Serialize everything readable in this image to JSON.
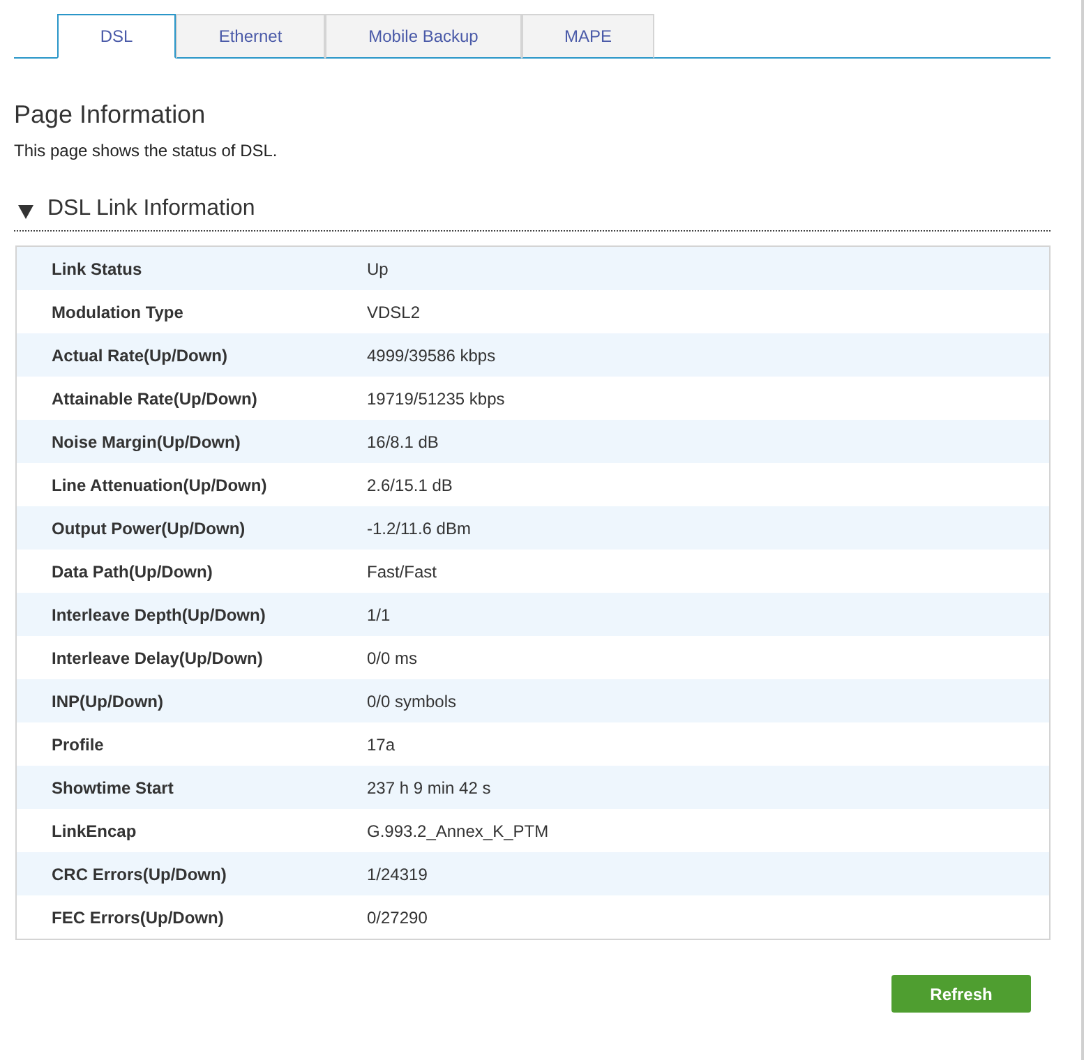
{
  "tabs": [
    {
      "label": "DSL",
      "selected": true
    },
    {
      "label": "Ethernet",
      "selected": false
    },
    {
      "label": "Mobile Backup",
      "selected": false
    },
    {
      "label": "MAPE",
      "selected": false
    }
  ],
  "page": {
    "title": "Page Information",
    "description": "This page shows the status of DSL."
  },
  "section": {
    "title": "DSL Link Information",
    "expanded": true,
    "rows": [
      {
        "label": "Link Status",
        "value": "Up"
      },
      {
        "label": "Modulation Type",
        "value": "VDSL2"
      },
      {
        "label": "Actual Rate(Up/Down)",
        "value": "4999/39586 kbps"
      },
      {
        "label": "Attainable Rate(Up/Down)",
        "value": "19719/51235 kbps"
      },
      {
        "label": "Noise Margin(Up/Down)",
        "value": "16/8.1 dB"
      },
      {
        "label": "Line Attenuation(Up/Down)",
        "value": "2.6/15.1 dB"
      },
      {
        "label": "Output Power(Up/Down)",
        "value": "-1.2/11.6 dBm"
      },
      {
        "label": "Data Path(Up/Down)",
        "value": "Fast/Fast"
      },
      {
        "label": "Interleave Depth(Up/Down)",
        "value": "1/1"
      },
      {
        "label": "Interleave Delay(Up/Down)",
        "value": "0/0 ms"
      },
      {
        "label": "INP(Up/Down)",
        "value": "0/0 symbols"
      },
      {
        "label": "Profile",
        "value": "17a"
      },
      {
        "label": "Showtime Start",
        "value": "237 h 9 min 42 s"
      },
      {
        "label": "LinkEncap",
        "value": "G.993.2_Annex_K_PTM"
      },
      {
        "label": "CRC Errors(Up/Down)",
        "value": "1/24319"
      },
      {
        "label": "FEC Errors(Up/Down)",
        "value": "0/27290"
      }
    ]
  },
  "buttons": [
    {
      "label": "Refresh"
    }
  ]
}
